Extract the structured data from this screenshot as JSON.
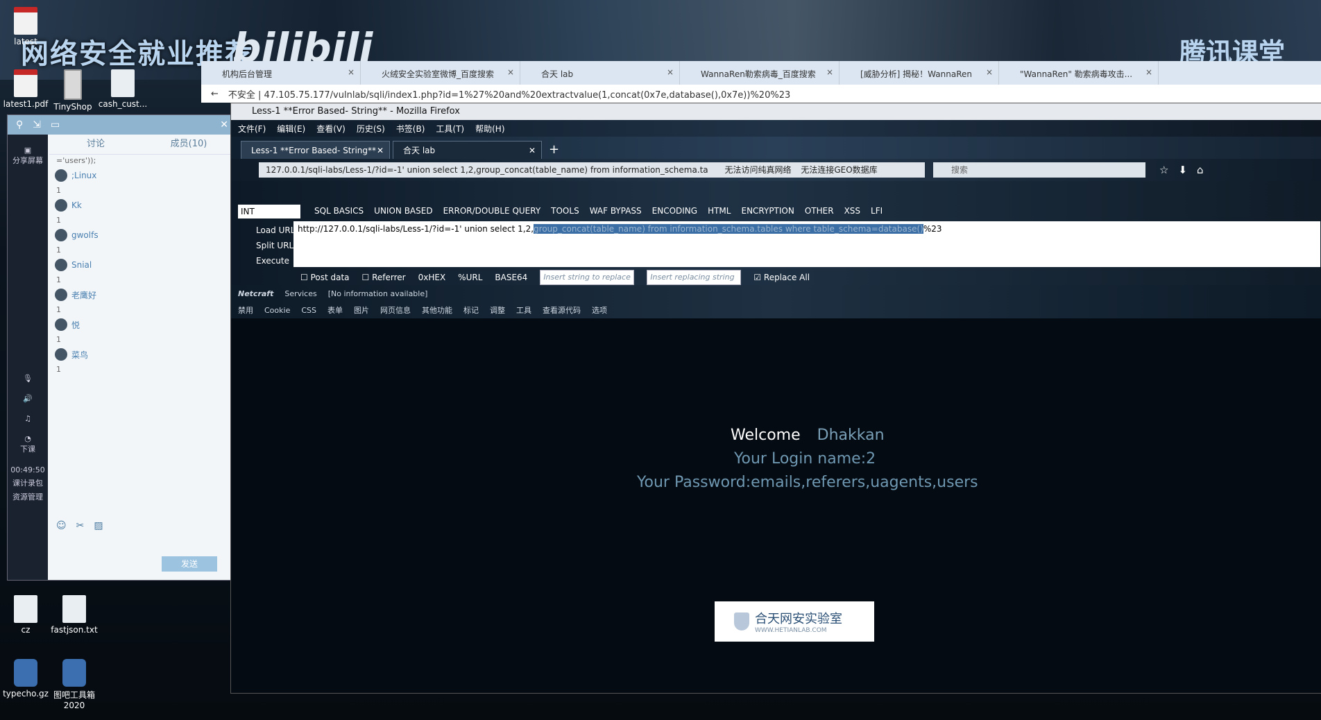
{
  "desktop": {
    "watermark_left": "网络安全就业推荐",
    "watermark_bili": "bilibili",
    "watermark_right": "腾讯课堂",
    "icons_top": [
      "latest",
      "TinyShop",
      "cash_cust...",
      "latest1.pdf"
    ],
    "icons_bottom": [
      "cz",
      "fastjson.txt",
      "typecho.gz",
      "图吧工具箱 2020"
    ]
  },
  "chat": {
    "share_label": "分享屏幕",
    "tab_discuss": "讨论",
    "tab_members": "成员(10)",
    "snippet": "='users'));",
    "messages": [
      {
        "name": ";Linux",
        "text": "1"
      },
      {
        "name": "Kk",
        "text": "1"
      },
      {
        "name": "gwolfs",
        "text": "1"
      },
      {
        "name": "Snial",
        "text": "1"
      },
      {
        "name": "老鹰好",
        "text": "1"
      },
      {
        "name": "悦",
        "text": "1"
      },
      {
        "name": "菜鸟",
        "text": "1"
      }
    ],
    "side_down": "下课",
    "side_time": "00:49:50",
    "side_rec": "课计录包",
    "side_res": "资源管理",
    "send_button": "发送"
  },
  "outer_browser": {
    "tabs": [
      "机构后台管理",
      "火绒安全实验室微博_百度搜索",
      "合天 lab",
      "WannaRen勒索病毒_百度搜索",
      "[威胁分析] 揭秘！WannaRen",
      "\"WannaRen\" 勒索病毒攻击..."
    ],
    "url": "不安全 | 47.105.75.177/vulnlab/sqli/index1.php?id=1%27%20and%20extractvalue(1,concat(0x7e,database(),0x7e))%20%23"
  },
  "firefox": {
    "title": "Less-1 **Error Based- String** - Mozilla Firefox",
    "menu": [
      "文件(F)",
      "编辑(E)",
      "查看(V)",
      "历史(S)",
      "书签(B)",
      "工具(T)",
      "帮助(H)"
    ],
    "tabs": [
      "Less-1 **Error Based- String**",
      "合天 lab"
    ],
    "url": "127.0.0.1/sqli-labs/Less-1/?id=-1' union select 1,2,group_concat(table_name) from information_schema.ta",
    "url_notice1": "无法访问纯真网络",
    "url_notice2": "无法连接GEO数据库",
    "search_placeholder": "搜索"
  },
  "hackbar": {
    "select_value": "INT",
    "menu": [
      "SQL BASICS",
      "UNION BASED",
      "ERROR/DOUBLE QUERY",
      "TOOLS",
      "WAF BYPASS",
      "ENCODING",
      "HTML",
      "ENCRYPTION",
      "OTHER",
      "XSS",
      "LFI"
    ],
    "load_url": "Load URL",
    "split_url": "Split URL",
    "execute": "Execute",
    "url_prefix": "http://127.0.0.1/sqli-labs/Less-1/?id=-1' union select 1,2,",
    "url_selected": "group_concat(table_name) from information_schema.tables where table_schema=database()",
    "url_suffix": "%23",
    "post_data": "Post data",
    "referrer": "Referrer",
    "hex": "0xHEX",
    "urlenc": "%URL",
    "base64": "BASE64",
    "insert_replace_ph": "Insert string to replace",
    "insert_replacing_ph": "Insert replacing string",
    "replace_all": "Replace All",
    "netcraft": "Netcraft",
    "services": "Services",
    "no_info": "[No information available]",
    "toolbar2": [
      "禁用",
      "Cookie",
      "CSS",
      "表单",
      "图片",
      "网页信息",
      "其他功能",
      "标记",
      "调整",
      "工具",
      "查看源代码",
      "选项"
    ]
  },
  "page": {
    "welcome": "Welcome",
    "user": "Dhakkan",
    "login": "Your Login name:2",
    "password": "Your Password:emails,referers,uagents,users",
    "logo_cn": "合天网安实验室",
    "logo_en": "WWW.HETIANLAB.COM"
  }
}
